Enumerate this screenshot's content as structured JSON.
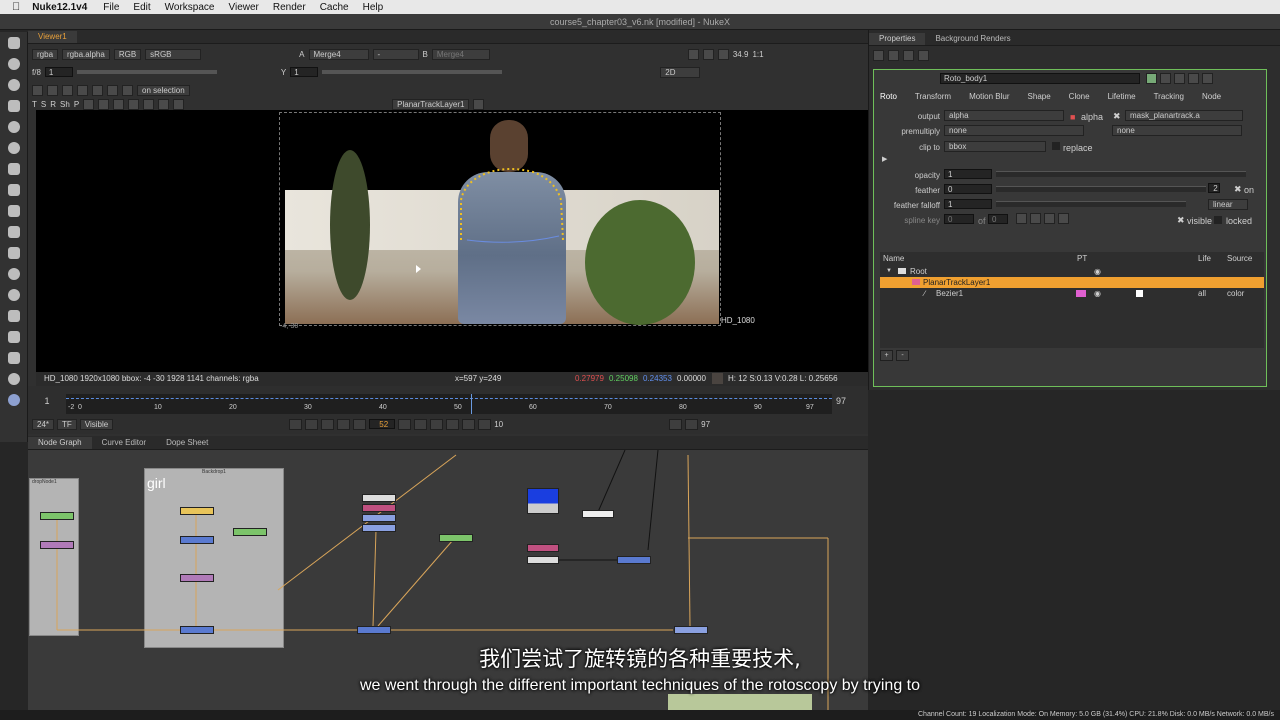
{
  "menubar": {
    "app": "Nuke12.1v4",
    "items": [
      "File",
      "Edit",
      "Workspace",
      "Viewer",
      "Render",
      "Cache",
      "Help"
    ],
    "window_title": "course5_chapter03_v6.nk [modified] - NukeX"
  },
  "viewer": {
    "tab": "Viewer1",
    "channels": "rgba",
    "alpha": "rgba.alpha",
    "display": "RGB",
    "colorspace": "sRGB",
    "input_a": "Merge4",
    "input_b_dash": "-",
    "input_b": "Merge4",
    "zoom": "34.9",
    "ratio": "1:1",
    "view": "2D",
    "fstop": "f/8",
    "gain": "1",
    "y_label": "Y",
    "gamma": "1",
    "on_selection": "on selection",
    "tool_letters": [
      "T",
      "S",
      "R",
      "Sh",
      "P"
    ],
    "track_layer": "PlanarTrackLayer1",
    "format_label": "HD_1080",
    "corner_coord": "-4,-30",
    "status_left": "HD_1080 1920x1080  bbox: -4 -30 1928 1141 channels: rgba",
    "cursor": "x=597 y=249",
    "r": "0.27979",
    "g": "0.25098",
    "b": "0.24353",
    "a": "0.00000",
    "hsvl": "H: 12 S:0.13 V:0.28  L: 0.25656"
  },
  "timeline": {
    "start": "1",
    "end": "97",
    "ticks": [
      "-2",
      "0",
      "10",
      "20",
      "30",
      "40",
      "50",
      "60",
      "70",
      "80",
      "90",
      "97"
    ],
    "fps": "24*",
    "tf": "TF",
    "visible": "Visible",
    "current_frame": "52",
    "step": "10",
    "end_frame": "97"
  },
  "nodegraph": {
    "tabs": [
      "Node Graph",
      "Curve Editor",
      "Dope Sheet"
    ],
    "backdrop_label": "girl",
    "backdrop_title": "Backdrop1",
    "backdrop_title2": "dropNode1"
  },
  "properties": {
    "tabs": [
      "Properties",
      "Background Renders"
    ],
    "node_name": "Roto_body1",
    "subtabs": [
      "Roto",
      "Transform",
      "Motion Blur",
      "Shape",
      "Clone",
      "Lifetime",
      "Tracking",
      "Node"
    ],
    "output_label": "output",
    "output_value": "alpha",
    "alpha_check": "alpha",
    "mask_value": "mask_planartrack.a",
    "premultiply_label": "premultiply",
    "premultiply_value": "none",
    "premultiply_value2": "none",
    "clip_label": "clip to",
    "clip_value": "bbox",
    "replace": "replace",
    "opacity_label": "opacity",
    "opacity_value": "1",
    "feather_label": "feather",
    "feather_value": "0",
    "falloff_label": "feather falloff",
    "falloff_value": "1",
    "falloff_type": "linear",
    "spline_key_label": "spline key",
    "spline_key_value": "0",
    "of_label": "of",
    "of_value": "0",
    "on_label": "on",
    "feather_num": "2",
    "visible": "visible",
    "locked": "locked",
    "layer_headers": [
      "Name",
      "PT",
      "Life",
      "Source"
    ],
    "layers": [
      {
        "name": "Root",
        "life": "",
        "source": ""
      },
      {
        "name": "PlanarTrackLayer1",
        "life": "",
        "source": ""
      },
      {
        "name": "Bezier1",
        "life": "all",
        "source": "color"
      }
    ]
  },
  "footer": "Channel Count: 19  Localization Mode: On  Memory: 5.0 GB (31.4%)  CPU: 21.8%  Disk: 0.0 MB/s  Network: 0.0 MB/s",
  "subtitle": {
    "zh": "我们尝试了旋转镜的各种重要技术,",
    "en": "we went through the different important techniques of the rotoscopy by trying to"
  }
}
